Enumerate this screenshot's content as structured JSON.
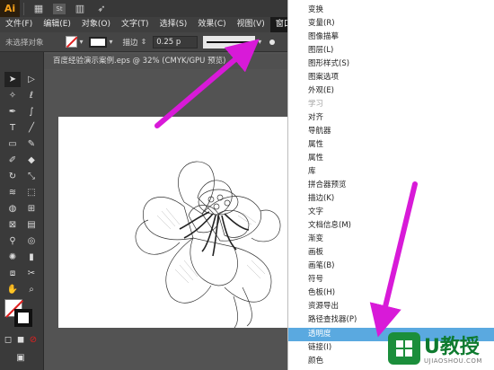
{
  "appbar": {
    "logo": "Ai",
    "st_badge": "St"
  },
  "menubar": {
    "items": [
      "文件(F)",
      "编辑(E)",
      "对象(O)",
      "文字(T)",
      "选择(S)",
      "效果(C)",
      "视图(V)",
      "窗口(W)"
    ],
    "active": "窗口(W)"
  },
  "controlbar": {
    "selection_status": "未选择对象",
    "stroke_label": "描边",
    "stroke_value": "0.25 p"
  },
  "document_tab": {
    "title": "百度经验演示案例.eps @ 32% (CMYK/GPU 预览)"
  },
  "window_menu": {
    "items": [
      {
        "label": "变换",
        "disabled": false,
        "highlighted": false
      },
      {
        "label": "变量(R)",
        "disabled": false,
        "highlighted": false
      },
      {
        "label": "图像描摹",
        "disabled": false,
        "highlighted": false
      },
      {
        "label": "图层(L)",
        "disabled": false,
        "highlighted": false
      },
      {
        "label": "图形样式(S)",
        "disabled": false,
        "highlighted": false
      },
      {
        "label": "图案选项",
        "disabled": false,
        "highlighted": false
      },
      {
        "label": "外观(E)",
        "disabled": false,
        "highlighted": false
      },
      {
        "label": "学习",
        "disabled": true,
        "highlighted": false
      },
      {
        "label": "对齐",
        "disabled": false,
        "highlighted": false
      },
      {
        "label": "导航器",
        "disabled": false,
        "highlighted": false
      },
      {
        "label": "属性",
        "disabled": false,
        "highlighted": false
      },
      {
        "label": "属性",
        "disabled": false,
        "highlighted": false
      },
      {
        "label": "库",
        "disabled": false,
        "highlighted": false
      },
      {
        "label": "拼合器预览",
        "disabled": false,
        "highlighted": false
      },
      {
        "label": "描边(K)",
        "disabled": false,
        "highlighted": false
      },
      {
        "label": "文字",
        "disabled": false,
        "highlighted": false
      },
      {
        "label": "文档信息(M)",
        "disabled": false,
        "highlighted": false
      },
      {
        "label": "渐变",
        "disabled": false,
        "highlighted": false
      },
      {
        "label": "画板",
        "disabled": false,
        "highlighted": false
      },
      {
        "label": "画笔(B)",
        "disabled": false,
        "highlighted": false
      },
      {
        "label": "符号",
        "disabled": false,
        "highlighted": false
      },
      {
        "label": "色板(H)",
        "disabled": false,
        "highlighted": false
      },
      {
        "label": "资源导出",
        "disabled": false,
        "highlighted": false
      },
      {
        "label": "路径查找器(P)",
        "disabled": false,
        "highlighted": false
      },
      {
        "label": "透明度",
        "disabled": false,
        "highlighted": true
      },
      {
        "label": "链接(I)",
        "disabled": false,
        "highlighted": false
      },
      {
        "label": "颜色",
        "disabled": false,
        "highlighted": false
      }
    ]
  },
  "watermark": {
    "title": "U教授",
    "subtitle": "UJIAOSHOU.COM"
  },
  "colors": {
    "arrow": "#d81ad8",
    "highlight": "#5aa9e0",
    "ai_orange": "#f7a21b",
    "watermark_green": "#0e7a2f"
  }
}
